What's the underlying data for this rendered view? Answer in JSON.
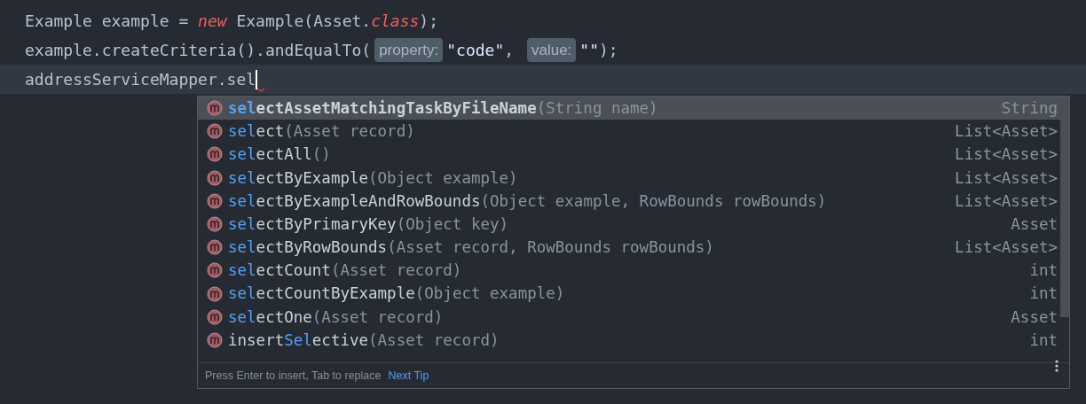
{
  "editor": {
    "lines": [
      {
        "current": false,
        "tokens": [
          {
            "kind": "plain",
            "text": "Example example = "
          },
          {
            "kind": "keyword",
            "text": "new"
          },
          {
            "kind": "plain",
            "text": " Example(Asset."
          },
          {
            "kind": "keyword",
            "text": "class"
          },
          {
            "kind": "plain",
            "text": ");"
          }
        ]
      },
      {
        "current": false,
        "tokens": [
          {
            "kind": "plain",
            "text": "example.createCriteria().andEqualTo("
          },
          {
            "kind": "hint",
            "text": "property:"
          },
          {
            "kind": "string",
            "text": "\"code\""
          },
          {
            "kind": "plain",
            "text": ", "
          },
          {
            "kind": "hint",
            "text": "value:"
          },
          {
            "kind": "string",
            "text": "\"\""
          },
          {
            "kind": "plain",
            "text": ");"
          }
        ]
      },
      {
        "current": true,
        "tokens": [
          {
            "kind": "plain",
            "text": "addressServiceMapper.sel"
          },
          {
            "kind": "caret"
          }
        ]
      }
    ]
  },
  "completion": {
    "items": [
      {
        "match": "sel",
        "after": "ectAssetMatchingTaskByFileName",
        "params": "(String name)",
        "type": "String",
        "selected": true
      },
      {
        "match": "sel",
        "after": "ect",
        "params": "(Asset record)",
        "type": "List<Asset>",
        "selected": false
      },
      {
        "match": "sel",
        "after": "ectAll",
        "params": "()",
        "type": "List<Asset>",
        "selected": false
      },
      {
        "match": "sel",
        "after": "ectByExample",
        "params": "(Object example)",
        "type": "List<Asset>",
        "selected": false
      },
      {
        "match": "sel",
        "after": "ectByExampleAndRowBounds",
        "params": "(Object example, RowBounds rowBounds)",
        "type": "List<Asset>",
        "selected": false
      },
      {
        "match": "sel",
        "after": "ectByPrimaryKey",
        "params": "(Object key)",
        "type": "Asset",
        "selected": false
      },
      {
        "match": "sel",
        "after": "ectByRowBounds",
        "params": "(Asset record, RowBounds rowBounds)",
        "type": "List<Asset>",
        "selected": false
      },
      {
        "match": "sel",
        "after": "ectCount",
        "params": "(Asset record)",
        "type": "int",
        "selected": false
      },
      {
        "match": "sel",
        "after": "ectCountByExample",
        "params": "(Object example)",
        "type": "int",
        "selected": false
      },
      {
        "match": "sel",
        "after": "ectOne",
        "params": "(Asset record)",
        "type": "Asset",
        "selected": false
      },
      {
        "before": "insert",
        "match": "Sel",
        "after": "ective",
        "params": "(Asset record)",
        "type": "int",
        "selected": false
      }
    ],
    "footer": {
      "hint": "Press Enter to insert, Tab to replace",
      "link": "Next Tip"
    }
  }
}
